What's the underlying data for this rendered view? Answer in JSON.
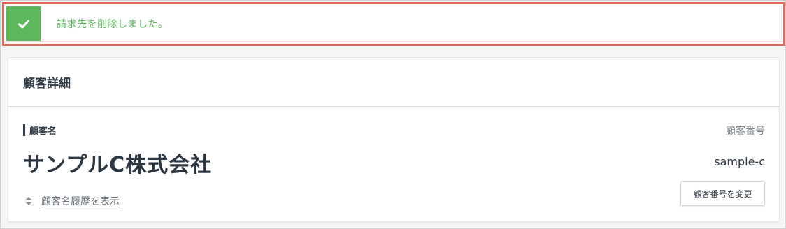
{
  "notification": {
    "message": "請求先を削除しました。",
    "icon": "check-icon",
    "color": "#5cb85c",
    "highlight_color": "#e06b5a"
  },
  "card": {
    "title": "顧客詳細",
    "customer_name_label": "顧客名",
    "customer_name": "サンプルC株式会社",
    "history_link": "顧客名履歴を表示",
    "history_icon": "sort-icon",
    "customer_number_label": "顧客番号",
    "customer_number": "sample-c",
    "change_number_button": "顧客番号を変更"
  }
}
